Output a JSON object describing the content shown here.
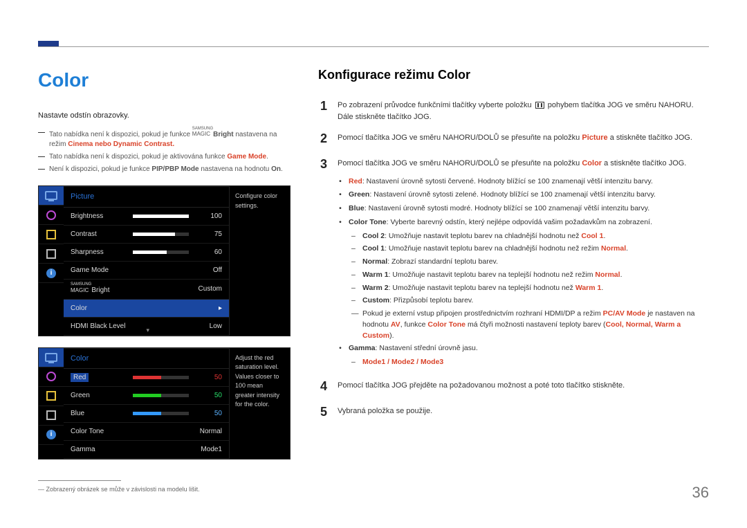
{
  "page_number": "36",
  "left": {
    "title": "Color",
    "desc": "Nastavte odstín obrazovky.",
    "notes": [
      {
        "pre": "Tato nabídka není k dispozici, pokud je funkce ",
        "magic": "Bright",
        "post": " nastavena na režim ",
        "tail": "Cinema nebo Dynamic Contrast."
      },
      {
        "plain_pre": "Tato nabídka není k dispozici, pokud je aktivována funkce ",
        "red": "Game Mode",
        "plain_post": "."
      },
      {
        "plain_pre": "Není k dispozici, pokud je funkce ",
        "bold1": "PIP/PBP Mode",
        "mid": " nastavena na hodnotu ",
        "bold2": "On",
        "plain_post": "."
      }
    ],
    "osd1": {
      "header": "Picture",
      "help": "Configure color settings.",
      "rows": [
        {
          "label": "Brightness",
          "val": "100",
          "fill": 100,
          "bar": true
        },
        {
          "label": "Contrast",
          "val": "75",
          "fill": 75,
          "bar": true
        },
        {
          "label": "Sharpness",
          "val": "60",
          "fill": 60,
          "bar": true
        },
        {
          "label": "Game Mode",
          "val": "Off",
          "bar": false
        },
        {
          "label_magic": "Bright",
          "val": "Custom",
          "bar": false
        },
        {
          "label": "Color",
          "val": "",
          "bar": false,
          "highlight": true,
          "arrow": "▸"
        },
        {
          "label": "HDMI Black Level",
          "val": "Low",
          "bar": false,
          "carat": true
        }
      ]
    },
    "osd2": {
      "header": "Color",
      "help": "Adjust the red saturation level. Values closer to 100 mean greater intensity for the color.",
      "rows": [
        {
          "label": "Red",
          "val": "50",
          "fill": 50,
          "barcolor": "#d33",
          "hl": true
        },
        {
          "label": "Green",
          "val": "50",
          "fill": 50,
          "barcolor": "#2c2",
          "valcol": "#28df6a"
        },
        {
          "label": "Blue",
          "val": "50",
          "fill": 50,
          "barcolor": "#39f",
          "valcol": "#5bb2ff"
        },
        {
          "label": "Color Tone",
          "val": "Normal",
          "bar": false
        },
        {
          "label": "Gamma",
          "val": "Mode1",
          "bar": false
        }
      ]
    },
    "footnote": "Zobrazený obrázek se může v závislosti na modelu lišit."
  },
  "right": {
    "title": "Konfigurace režimu Color",
    "step1_pre": "Po zobrazení průvodce funkčními tlačítky vyberte položku ",
    "step1_post": " pohybem tlačítka JOG ve směru NAHORU. Dále stiskněte tlačítko JOG.",
    "step2_pre": "Pomocí tlačítka JOG ve směru NAHORU/DOLŮ se přesuňte na položku ",
    "step2_bold": "Picture",
    "step2_post": " a stiskněte tlačítko JOG.",
    "step3_pre": "Pomocí tlačítka JOG ve směru NAHORU/DOLŮ se přesuňte na položku ",
    "step3_bold": "Color",
    "step3_post": " a stiskněte tlačítko JOG.",
    "bullets": {
      "red": {
        "k": "Red",
        "t": ": Nastavení úrovně sytosti červené. Hodnoty blížící se 100 znamenají větší intenzitu barvy."
      },
      "green": {
        "k": "Green",
        "t": ": Nastavení úrovně sytosti zelené. Hodnoty blížící se 100 znamenají větší intenzitu barvy."
      },
      "blue": {
        "k": "Blue",
        "t": ": Nastavení úrovně sytosti modré. Hodnoty blížící se 100 znamenají větší intenzitu barvy."
      },
      "colortone": {
        "k": "Color Tone",
        "t": ": Vyberte barevný odstín, který nejlépe odpovídá vašim požadavkům na zobrazení."
      },
      "ct_sub": [
        {
          "k": "Cool 2",
          "t": ": Umožňuje nastavit teplotu barev na chladnější hodnotu než ",
          "tail": "Cool 1",
          "tail2": "."
        },
        {
          "k": "Cool 1",
          "t": ": Umožňuje nastavit teplotu barev na chladnější hodnotu než režim ",
          "tail": "Normal",
          "tail2": "."
        },
        {
          "k": "Normal",
          "t": ": Zobrazí standardní teplotu barev.",
          "tail": "",
          "tail2": ""
        },
        {
          "k": "Warm 1",
          "t": ": Umožňuje nastavit teplotu barev na teplejší hodnotu než režim ",
          "tail": "Normal",
          "tail2": "."
        },
        {
          "k": "Warm 2",
          "t": ": Umožňuje nastavit teplotu barev na teplejší hodnotu než ",
          "tail": "Warm 1",
          "tail2": "."
        },
        {
          "k": "Custom",
          "t": ": Přizpůsobí teplotu barev.",
          "tail": "",
          "tail2": ""
        }
      ],
      "ct_note_pre": "Pokud je externí vstup připojen prostřednictvím rozhraní HDMI/DP a režim ",
      "ct_note_b1": "PC/AV Mode",
      "ct_note_mid": " je nastaven na hodnotu ",
      "ct_note_b2": "AV",
      "ct_note_post1": ", funkce ",
      "ct_note_b3": "Color Tone",
      "ct_note_post2": " má čtyři možnosti nastavení teploty barev (",
      "ct_note_opts": "Cool, Normal, Warm a Custom",
      "ct_note_close": ").",
      "gamma": {
        "k": "Gamma",
        "t": ": Nastavení střední úrovně jasu."
      },
      "gamma_sub": "Mode1 / Mode2 / Mode3"
    },
    "step4": "Pomocí tlačítka JOG přejděte na požadovanou možnost a poté toto tlačítko stiskněte.",
    "step5": "Vybraná položka se použije."
  }
}
